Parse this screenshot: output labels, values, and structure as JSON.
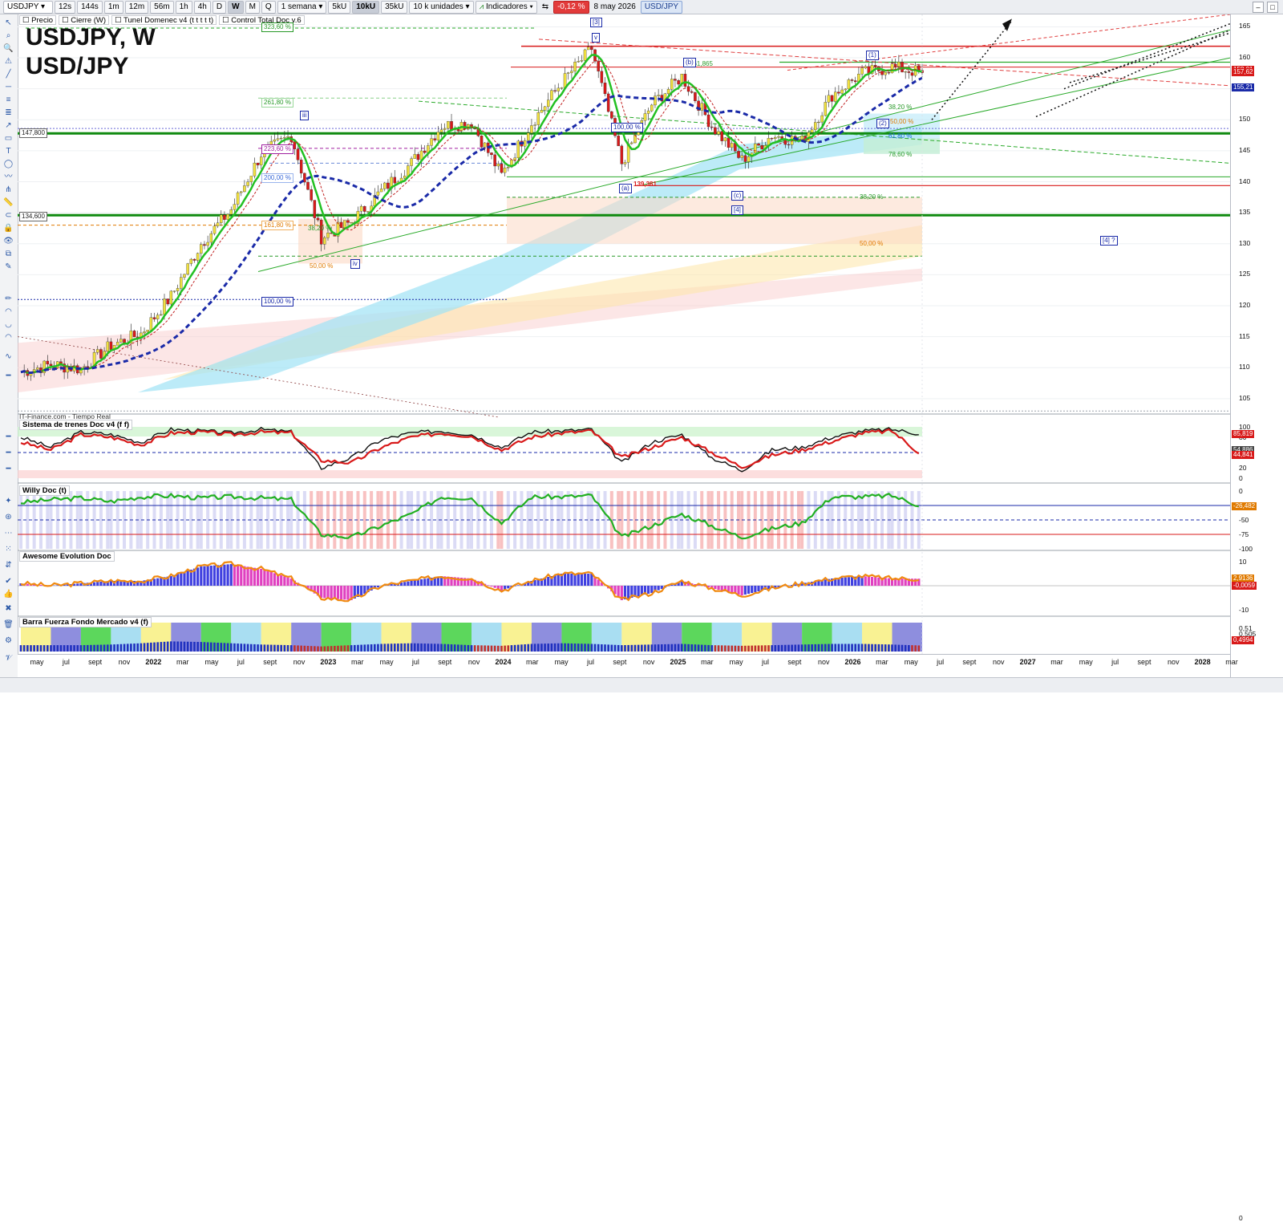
{
  "toolbar": {
    "symbol": "USDJPY",
    "intervals": [
      "12s",
      "144s",
      "1m",
      "12m",
      "56m",
      "1h",
      "4h",
      "D",
      "W",
      "M",
      "Q"
    ],
    "active_interval": "W",
    "range": "1 semana",
    "sizes": [
      "5kU",
      "10kU",
      "35kU"
    ],
    "active_size": "10kU",
    "units": "10 k unidades",
    "indicators": "Indicadores",
    "change": "-0,12 %",
    "date": "8 may 2026",
    "symbol_tag": "USD/JPY"
  },
  "legend": {
    "items": [
      "Precio",
      "Cierre (W)",
      "Tunel Domenec v4 (t t t t t)",
      "Control Total Doc v.6"
    ]
  },
  "chart_title": {
    "line1": "USDJPY, W",
    "line2": "USD/JPY"
  },
  "credit": "IT-Finance.com - Tiempo Real",
  "panels": {
    "trend": "Sistema de trenes Doc v4 (f f)",
    "willy": "Willy Doc (t)",
    "awesome": "Awesome Evolution Doc",
    "barra": "Barra Fuerza Fondo Mercado v4 (f)"
  },
  "price_axis": {
    "ticks": [
      "165",
      "160",
      "155",
      "150",
      "145",
      "140",
      "135",
      "130",
      "125",
      "120",
      "115",
      "110",
      "105"
    ],
    "tags": [
      {
        "label": "158,01",
        "color": "#d81a1a"
      },
      {
        "label": "157,62",
        "color": "#d81a1a"
      },
      {
        "label": "155,21",
        "color": "#1a2aa8"
      }
    ]
  },
  "trend_axis": {
    "ticks": [
      "100",
      "80",
      "20",
      "0"
    ],
    "tags": [
      {
        "label": "85,819",
        "color": "#d81a1a"
      },
      {
        "label": "54,886",
        "color": "#444444"
      },
      {
        "label": "44,841",
        "color": "#d81a1a"
      }
    ]
  },
  "willy_axis": {
    "ticks": [
      "0",
      "-25",
      "-50",
      "-75",
      "-100"
    ],
    "tags": [
      {
        "label": "-26,482",
        "color": "#e07a00"
      }
    ]
  },
  "awesome_axis": {
    "ticks": [
      "10",
      "0",
      "-10"
    ],
    "tags": [
      {
        "label": "2,9136",
        "color": "#e07a00"
      },
      {
        "label": "-0,0059",
        "color": "#d81a1a"
      }
    ]
  },
  "barra_axis": {
    "ticks": [
      "0,51",
      "0,505",
      "0,5",
      "0"
    ],
    "tags": [
      {
        "label": "0,5000",
        "color": "#1a2aa8"
      },
      {
        "label": "0,4994",
        "color": "#d81a1a"
      }
    ]
  },
  "time_axis": [
    {
      "label": "may"
    },
    {
      "label": "jul"
    },
    {
      "label": "sept"
    },
    {
      "label": "nov"
    },
    {
      "label": "2022",
      "year": true
    },
    {
      "label": "mar"
    },
    {
      "label": "may"
    },
    {
      "label": "jul"
    },
    {
      "label": "sept"
    },
    {
      "label": "nov"
    },
    {
      "label": "2023",
      "year": true
    },
    {
      "label": "mar"
    },
    {
      "label": "may"
    },
    {
      "label": "jul"
    },
    {
      "label": "sept"
    },
    {
      "label": "nov"
    },
    {
      "label": "2024",
      "year": true
    },
    {
      "label": "mar"
    },
    {
      "label": "may"
    },
    {
      "label": "jul"
    },
    {
      "label": "sept"
    },
    {
      "label": "nov"
    },
    {
      "label": "2025",
      "year": true
    },
    {
      "label": "mar"
    },
    {
      "label": "may"
    },
    {
      "label": "jul"
    },
    {
      "label": "sept"
    },
    {
      "label": "nov"
    },
    {
      "label": "2026",
      "year": true
    },
    {
      "label": "mar"
    },
    {
      "label": "may"
    },
    {
      "label": "jul"
    },
    {
      "label": "sept"
    },
    {
      "label": "nov"
    },
    {
      "label": "2027",
      "year": true
    },
    {
      "label": "mar"
    },
    {
      "label": "may"
    },
    {
      "label": "jul"
    },
    {
      "label": "sept"
    },
    {
      "label": "nov"
    },
    {
      "label": "2028",
      "year": true
    },
    {
      "label": "mar"
    }
  ],
  "level_labels": {
    "l1": "147,800",
    "l2": "134,600",
    "low1": "139,381",
    "high1": "161,865"
  },
  "fib_labels": {
    "f1": "323,60 %",
    "f2": "261,80 %",
    "f3": "223,60 %",
    "f4": "200,00 %",
    "f5": "161,80 %",
    "f6": "100,00 %",
    "f7": "38,20 %",
    "f8": "50,00 %",
    "f9": "100,00 %",
    "f10": "38,20 %",
    "f11": "50,00 %",
    "f12": "38,20 %",
    "f13": "50,00 %",
    "f14": "61,80 %",
    "f15": "78,60 %"
  },
  "wave_labels": {
    "w3": "[3]",
    "wv": "v",
    "wiii": "iii",
    "wiv": "iv",
    "wb": "(b)",
    "wa": "(a)",
    "wc": "(c)",
    "w4": "[4]",
    "w1": "(1)",
    "w2": "(2)",
    "w4q": "[4] ?"
  },
  "chart_data": [
    {
      "type": "candlestick",
      "title": "USDJPY, W",
      "subtitle": "USD/JPY",
      "xlabel": "",
      "ylabel": "",
      "ylim": [
        102,
        167
      ],
      "x": [
        "may",
        "jul",
        "sept",
        "nov",
        "2022",
        "mar",
        "may",
        "jul",
        "sept",
        "nov",
        "2023",
        "mar",
        "may",
        "jul",
        "sept",
        "nov",
        "2024",
        "mar",
        "may",
        "jul",
        "sept",
        "nov",
        "2025",
        "mar",
        "may",
        "jul",
        "sept",
        "nov",
        "2026",
        "mar",
        "may"
      ],
      "series": [
        {
          "values": [
            109.3,
            110.5,
            109.8,
            113.6,
            115.5,
            121.5,
            130.0,
            135.5,
            144.5,
            147.5,
            131.0,
            133.5,
            138.5,
            143.0,
            149.0,
            149.5,
            141.0,
            149.5,
            156.0,
            161.5,
            143.0,
            152.5,
            157.0,
            149.0,
            143.5,
            147.5,
            146.5,
            154.0,
            157.5,
            158.5,
            157.6
          ]
        }
      ],
      "levels": [
        147.8,
        134.6,
        139.381,
        161.865,
        158.01,
        157.62,
        155.21
      ]
    },
    {
      "type": "line",
      "title": "Sistema de trenes Doc v4 (f f)",
      "ylim": [
        0,
        100
      ],
      "x": [
        "may",
        "jul",
        "sept",
        "nov",
        "2022",
        "mar",
        "may",
        "jul",
        "sept",
        "nov",
        "2023",
        "mar",
        "may",
        "jul",
        "sept",
        "nov",
        "2024",
        "mar",
        "may",
        "jul",
        "sept",
        "nov",
        "2025",
        "mar",
        "may",
        "jul",
        "sept",
        "nov",
        "2026",
        "mar",
        "may"
      ],
      "series": [
        {
          "values": [
            80,
            60,
            90,
            85,
            70,
            95,
            92,
            88,
            95,
            90,
            20,
            40,
            75,
            88,
            92,
            85,
            60,
            90,
            92,
            95,
            30,
            70,
            85,
            40,
            15,
            55,
            60,
            80,
            92,
            95,
            85.819
          ]
        },
        {
          "values": [
            70,
            55,
            85,
            80,
            65,
            88,
            90,
            85,
            90,
            88,
            35,
            30,
            60,
            80,
            88,
            82,
            55,
            80,
            88,
            92,
            40,
            60,
            80,
            50,
            22,
            45,
            55,
            72,
            88,
            92,
            44.841
          ]
        }
      ]
    },
    {
      "type": "line",
      "title": "Willy Doc (t)",
      "ylim": [
        -100,
        0
      ],
      "x": [
        "may",
        "jul",
        "sept",
        "nov",
        "2022",
        "mar",
        "may",
        "jul",
        "sept",
        "nov",
        "2023",
        "mar",
        "may",
        "jul",
        "sept",
        "nov",
        "2024",
        "mar",
        "may",
        "jul",
        "sept",
        "nov",
        "2025",
        "mar",
        "may",
        "jul",
        "sept",
        "nov",
        "2026",
        "mar",
        "may"
      ],
      "series": [
        {
          "values": [
            -20,
            -15,
            -12,
            -18,
            -10,
            -8,
            -12,
            -10,
            -12,
            -15,
            -75,
            -80,
            -60,
            -40,
            -10,
            -12,
            -55,
            -10,
            -10,
            -8,
            -80,
            -60,
            -40,
            -60,
            -80,
            -65,
            -55,
            -10,
            -10,
            -8,
            -26.482
          ]
        }
      ]
    },
    {
      "type": "bar",
      "title": "Awesome Evolution Doc",
      "ylim": [
        -12,
        12
      ],
      "x": [
        "may",
        "jul",
        "sept",
        "nov",
        "2022",
        "mar",
        "may",
        "jul",
        "sept",
        "nov",
        "2023",
        "mar",
        "may",
        "jul",
        "sept",
        "nov",
        "2024",
        "mar",
        "may",
        "jul",
        "sept",
        "nov",
        "2025",
        "mar",
        "may",
        "jul",
        "sept",
        "nov",
        "2026",
        "mar",
        "may"
      ],
      "series": [
        {
          "values": [
            1,
            0,
            1,
            2,
            2,
            4,
            8,
            9,
            7,
            3,
            -5,
            -6,
            0,
            2,
            4,
            3,
            -2,
            2,
            5,
            5,
            -6,
            -3,
            2,
            -1,
            -4,
            -1,
            1,
            3,
            4,
            3,
            2.9136
          ]
        }
      ]
    },
    {
      "type": "bar",
      "title": "Barra Fuerza Fondo Mercado v4 (f)",
      "ylim": [
        0.49,
        0.515
      ],
      "x": [
        "may",
        "jul",
        "sept",
        "nov",
        "2022",
        "mar",
        "may",
        "jul",
        "sept",
        "nov",
        "2023",
        "mar",
        "may",
        "jul",
        "sept",
        "nov",
        "2024",
        "mar",
        "may",
        "jul",
        "sept",
        "nov",
        "2025",
        "mar",
        "may",
        "jul",
        "sept",
        "nov",
        "2026",
        "mar",
        "may"
      ],
      "series": [
        {
          "values": [
            0.5,
            0.5,
            0.5,
            0.501,
            0.503,
            0.506,
            0.505,
            0.503,
            0.501,
            0.5,
            0.498,
            0.5,
            0.502,
            0.503,
            0.502,
            0.5,
            0.499,
            0.502,
            0.503,
            0.502,
            0.5,
            0.501,
            0.502,
            0.5,
            0.499,
            0.5,
            0.501,
            0.502,
            0.502,
            0.501,
            0.4994
          ]
        }
      ]
    }
  ]
}
